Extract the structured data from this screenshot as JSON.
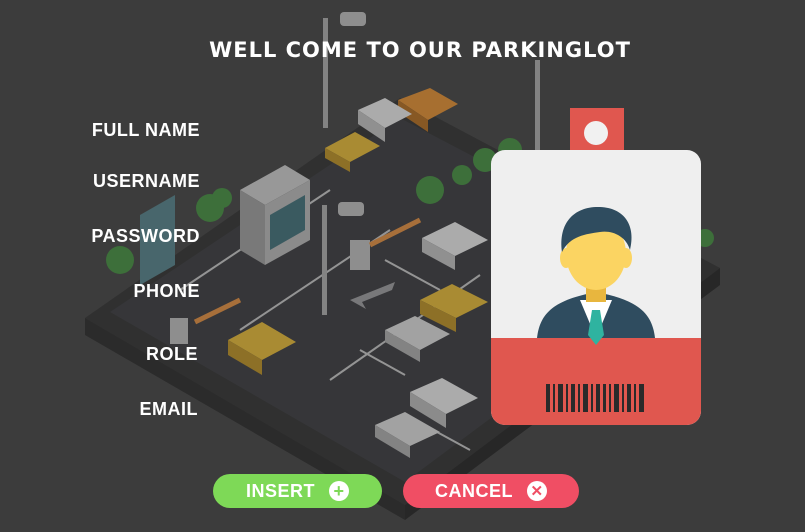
{
  "page": {
    "title": "WELL COME TO OUR PARKINGLOT"
  },
  "form": {
    "fields": [
      {
        "label": "FULL NAME",
        "value": ""
      },
      {
        "label": "USERNAME",
        "value": ""
      },
      {
        "label": "PASSWORD",
        "value": ""
      },
      {
        "label": "PHONE",
        "value": ""
      },
      {
        "label": "ROLE",
        "value": ""
      },
      {
        "label": "EMAIL",
        "value": ""
      }
    ]
  },
  "actions": {
    "insert_label": "INSERT",
    "insert_icon": "plus-circle-icon",
    "cancel_label": "CANCEL",
    "cancel_icon": "close-circle-icon"
  },
  "colors": {
    "background": "#3d3d3d",
    "insert": "#7ed957",
    "cancel": "#f04e64",
    "badge_red": "#e0574f"
  }
}
